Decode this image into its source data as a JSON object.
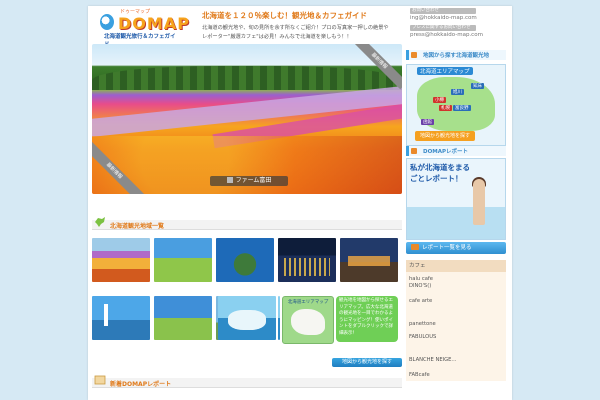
{
  "header": {
    "logo_kana": "ドゥーマップ",
    "logo_main": "DOMAP",
    "logo_sub": "北海道観光旅行＆カフェガイド",
    "tagline": "北海道を１２０％楽しむ！観光地＆カフェガイド",
    "desc1": "北海道の観光地や、旬の見所を余す所なくご紹介！プロの写真家一押しの絶景や",
    "desc2": "レポーター\"厳選カフェ\"は必見！みんなで北海道を楽しもう！！",
    "contact_label": "お問い合わせ",
    "contact_email": "ing@hokkaido-map.com",
    "press_label": "プレスに関するお問い合わせ",
    "press_email": "press@hokkaido-map.com"
  },
  "hero": {
    "tag_top": "最新情報",
    "tag_bottom": "最新情報",
    "caption": "ファーム富田"
  },
  "sightseeing": {
    "title": "北海道観光地域一覧",
    "thumbs": [
      "flower-field",
      "hill-road",
      "cape-island",
      "night-view",
      "canal-night",
      "lighthouse",
      "tree-lawn",
      "tv-tower",
      "drift-ice"
    ],
    "map_title": "北海道エリアマップ",
    "speech": "観光地を地図から探せるエリアマップ。広大な北海道の観光地を一目でわかるようにマッピング！使いポイントをダブルクリックで詳細表示！",
    "map_button": "地図から観光地を探す"
  },
  "news": {
    "title": "新着DOMAPレポート"
  },
  "sidebar": {
    "map_heading": "地図から探す北海道観光地",
    "map_title": "北海道エリアマップ",
    "pins": [
      "旭川",
      "知床",
      "小樽",
      "札幌",
      "函館",
      "富良野"
    ],
    "map_button": "地図から観光地を探す",
    "report_heading": "DOMAPレポート",
    "report_text": "私が北海道をまるごとレポート！",
    "report_button": "レポート一覧を見る",
    "cafe_heading": "カフェ",
    "cafes": [
      "halu cafe",
      "DINO'S()",
      "cafe arte",
      "panettone",
      "FABULOUS",
      "BLANCHE NEIGE...",
      "FABcafe"
    ]
  }
}
